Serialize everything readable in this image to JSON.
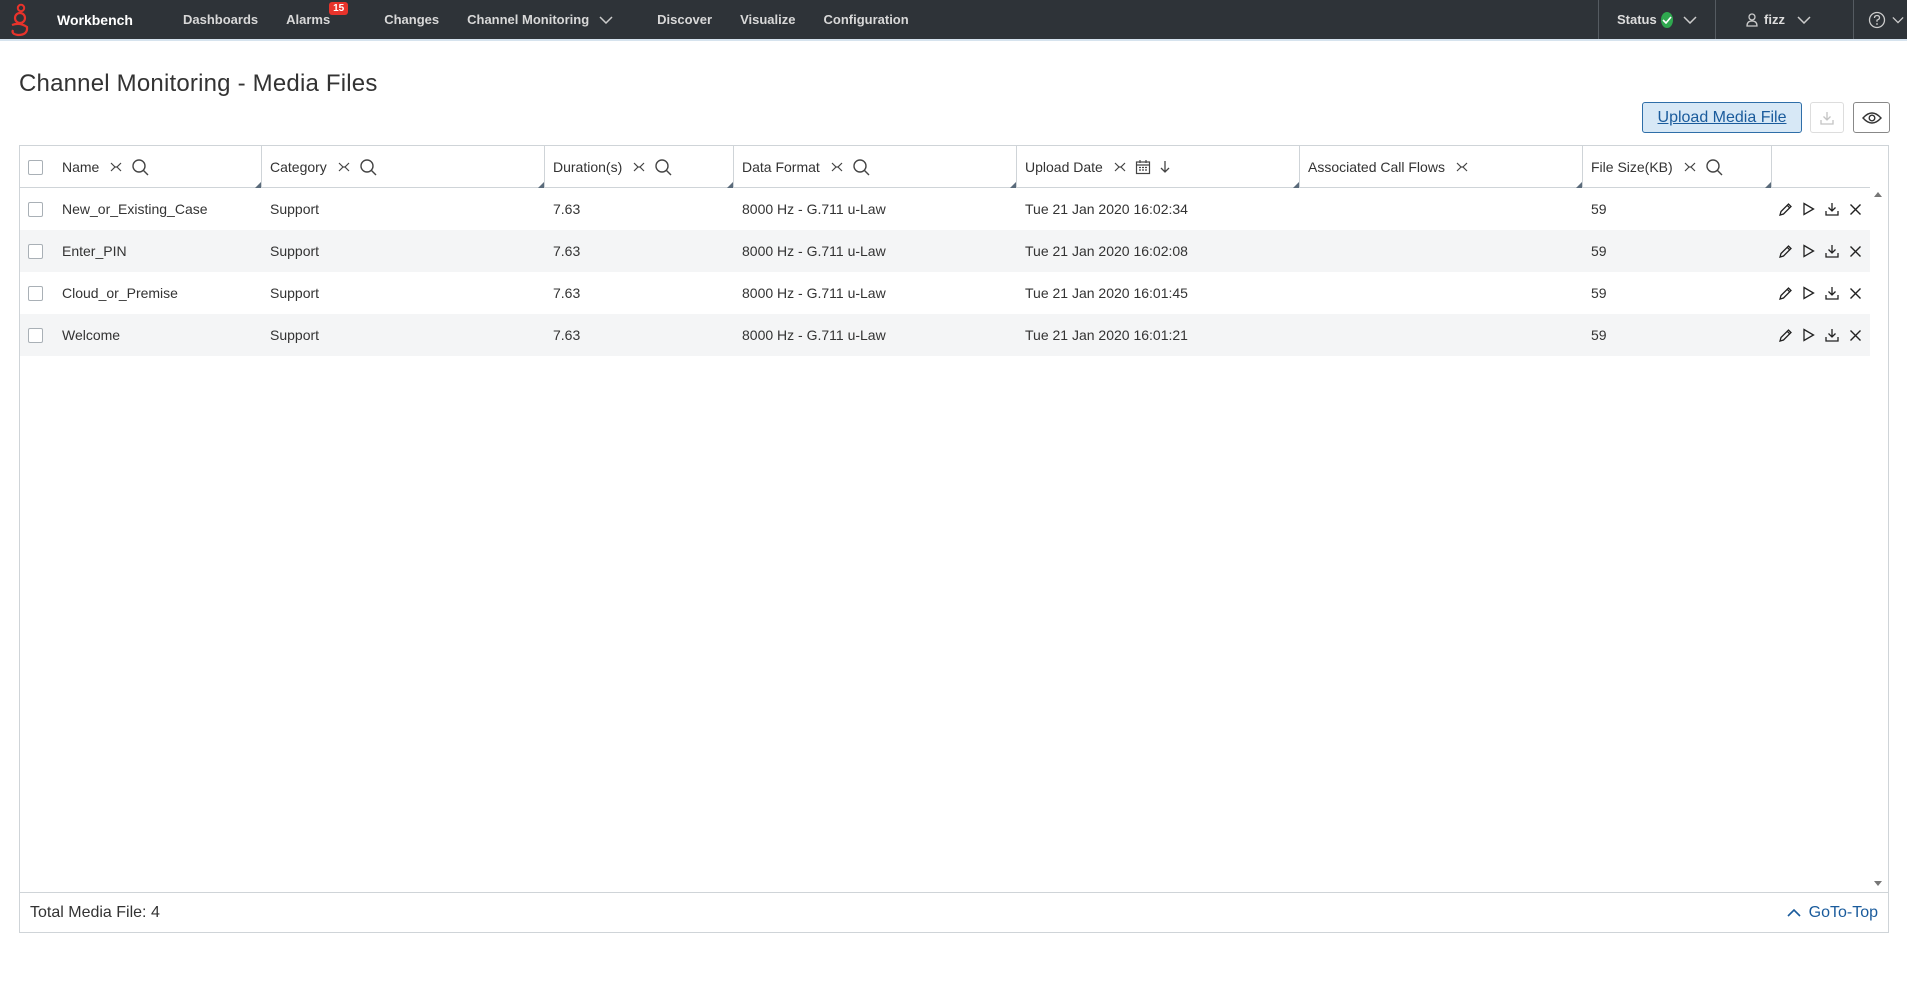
{
  "nav": {
    "brand": "Workbench",
    "items": [
      {
        "label": "Dashboards"
      },
      {
        "label": "Alarms",
        "badge": "15"
      },
      {
        "label": "Changes"
      },
      {
        "label": "Channel Monitoring"
      },
      {
        "label": "Discover"
      },
      {
        "label": "Visualize"
      },
      {
        "label": "Configuration"
      }
    ],
    "status_label": "Status",
    "user": "fizz",
    "colors": {
      "bar": "#2e3338",
      "badge": "#e8332b",
      "status_ok": "#2fa84f",
      "logo": "#e8332b"
    }
  },
  "page": {
    "title": "Channel Monitoring - Media Files"
  },
  "toolbar": {
    "upload_label": "Upload Media File"
  },
  "table": {
    "columns": [
      {
        "label": "Name"
      },
      {
        "label": "Category"
      },
      {
        "label": "Duration(s)"
      },
      {
        "label": "Data Format"
      },
      {
        "label": "Upload Date"
      },
      {
        "label": "Associated Call Flows"
      },
      {
        "label": "File Size(KB)"
      }
    ],
    "rows": [
      {
        "name": "New_or_Existing_Case",
        "category": "Support",
        "duration": "7.63",
        "format": "8000 Hz - G.711 u-Law",
        "date": "Tue 21 Jan 2020 16:02:34",
        "flows": "",
        "size": "59"
      },
      {
        "name": "Enter_PIN",
        "category": "Support",
        "duration": "7.63",
        "format": "8000 Hz - G.711 u-Law",
        "date": "Tue 21 Jan 2020 16:02:08",
        "flows": "",
        "size": "59"
      },
      {
        "name": "Cloud_or_Premise",
        "category": "Support",
        "duration": "7.63",
        "format": "8000 Hz - G.711 u-Law",
        "date": "Tue 21 Jan 2020 16:01:45",
        "flows": "",
        "size": "59"
      },
      {
        "name": "Welcome",
        "category": "Support",
        "duration": "7.63",
        "format": "8000 Hz - G.711 u-Law",
        "date": "Tue 21 Jan 2020 16:01:21",
        "flows": "",
        "size": "59"
      }
    ]
  },
  "footer": {
    "total": "Total Media File: 4",
    "goto": "GoTo-Top"
  }
}
